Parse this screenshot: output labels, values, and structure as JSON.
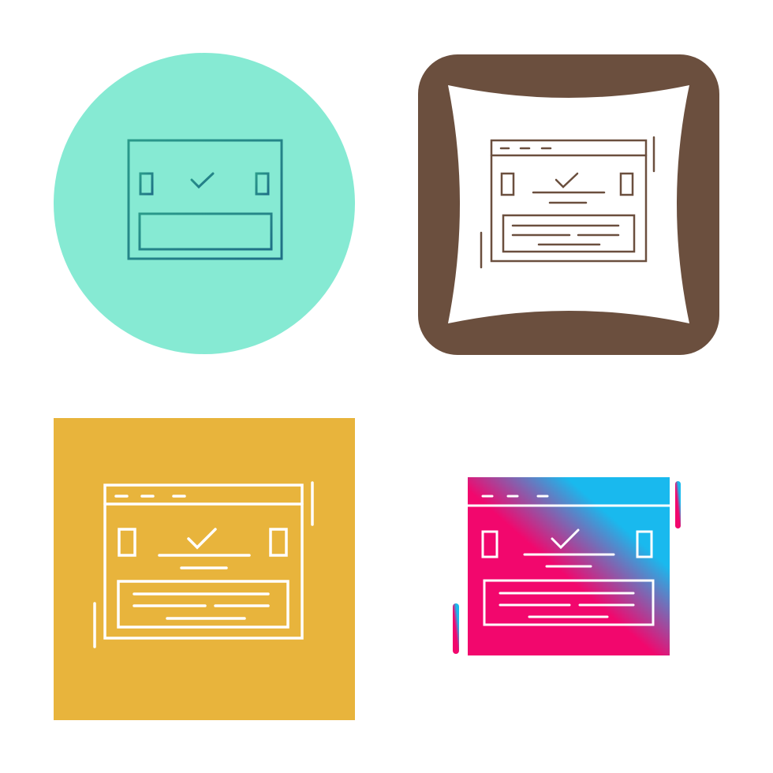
{
  "icon_set": {
    "icon": "browser-window-checkmark-icon",
    "variants": [
      {
        "style": "outline-on-circle",
        "background": "#86ead3",
        "stroke": "#2a9a8a",
        "stroke_gradient_end": "#1f6f86"
      },
      {
        "style": "outline-on-rounded-square",
        "background": "#6b4f3e",
        "panel": "#ffffff",
        "stroke": "#6b4f3e"
      },
      {
        "style": "outline-on-square",
        "background": "#e8b43c",
        "stroke": "#ffffff"
      },
      {
        "style": "glyph-gradient",
        "gradient_start": "#f2076d",
        "gradient_end": "#19b9ee"
      }
    ]
  }
}
